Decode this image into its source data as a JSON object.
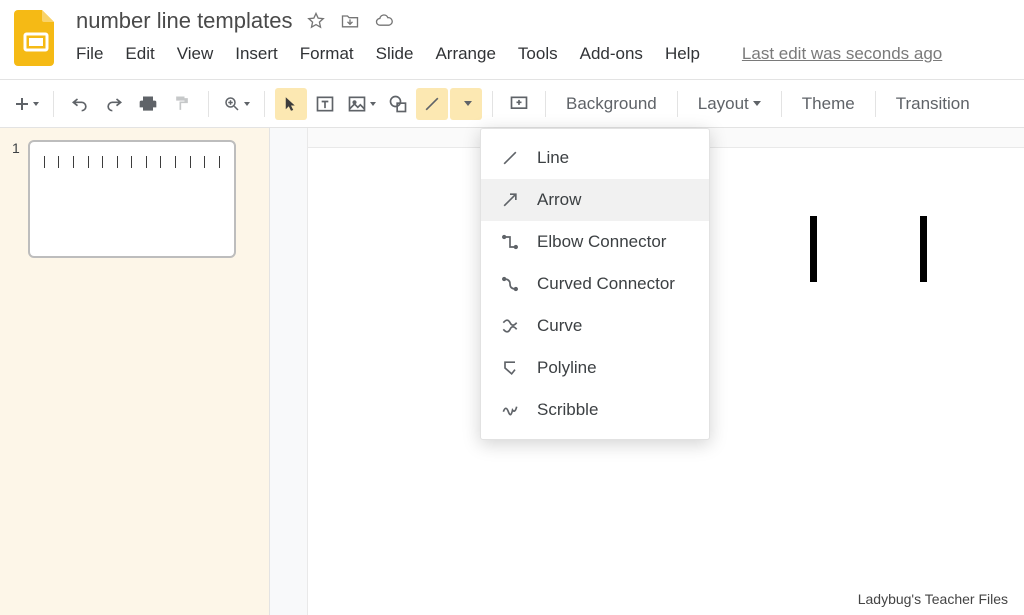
{
  "header": {
    "doc_title": "number line templates",
    "menu": [
      "File",
      "Edit",
      "View",
      "Insert",
      "Format",
      "Slide",
      "Arrange",
      "Tools",
      "Add-ons",
      "Help"
    ],
    "last_edit": "Last edit was seconds ago"
  },
  "toolbar": {
    "background": "Background",
    "layout": "Layout",
    "theme": "Theme",
    "transition": "Transition"
  },
  "sidebar": {
    "slides": [
      {
        "number": "1"
      }
    ]
  },
  "line_menu": {
    "items": [
      {
        "key": "line",
        "label": "Line"
      },
      {
        "key": "arrow",
        "label": "Arrow",
        "highlight": true
      },
      {
        "key": "elbow",
        "label": "Elbow Connector"
      },
      {
        "key": "curved",
        "label": "Curved Connector"
      },
      {
        "key": "curve",
        "label": "Curve"
      },
      {
        "key": "polyline",
        "label": "Polyline"
      },
      {
        "key": "scribble",
        "label": "Scribble"
      }
    ]
  },
  "watermark": "Ladybug's Teacher Files"
}
